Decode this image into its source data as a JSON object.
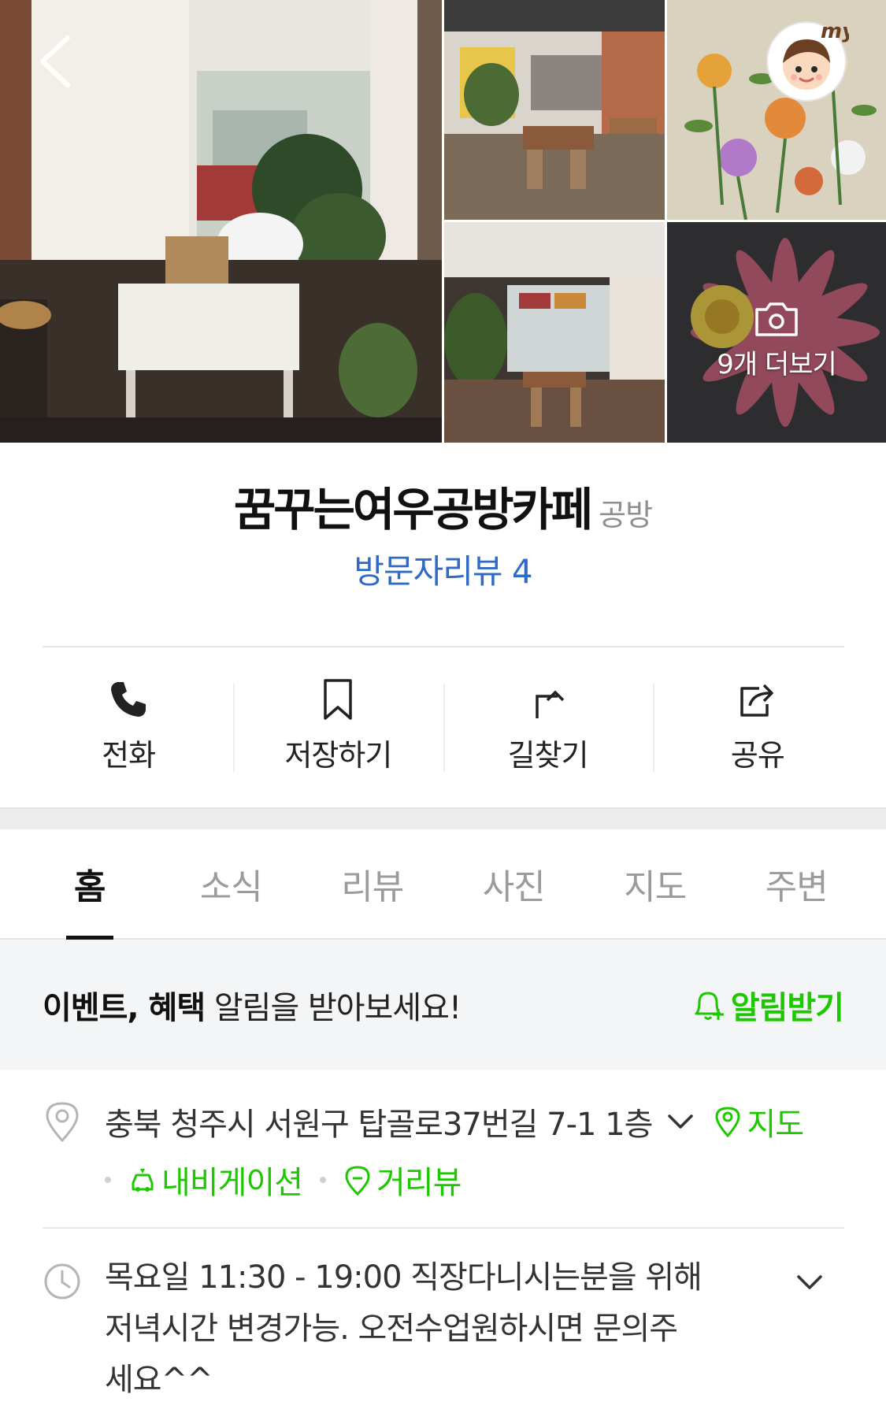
{
  "gallery": {
    "more_label": "9개 더보기",
    "images": [
      {
        "name": "interior-window-photo"
      },
      {
        "name": "cafe-tables-photo"
      },
      {
        "name": "embroidery-flowers-photo"
      },
      {
        "name": "cafe-hall-photo"
      },
      {
        "name": "embroidery-flower-closeup-photo"
      }
    ],
    "my_badge": "my"
  },
  "place": {
    "name": "꿈꾸는여우공방카페",
    "category": "공방",
    "review_label": "방문자리뷰 4"
  },
  "actions": [
    {
      "label": "전화",
      "icon": "phone-icon"
    },
    {
      "label": "저장하기",
      "icon": "bookmark-icon"
    },
    {
      "label": "길찾기",
      "icon": "directions-icon"
    },
    {
      "label": "공유",
      "icon": "share-icon"
    }
  ],
  "tabs": [
    {
      "label": "홈",
      "active": true
    },
    {
      "label": "소식"
    },
    {
      "label": "리뷰"
    },
    {
      "label": "사진"
    },
    {
      "label": "지도"
    },
    {
      "label": "주변"
    }
  ],
  "notice": {
    "bold_part": "이벤트, 혜택",
    "rest": " 알림을 받아보세요!",
    "button": "알림받기"
  },
  "address": {
    "text": "충북 청주시 서원구 탑골로37번길 7-1 1층",
    "map_label": "지도",
    "navigation_label": "내비게이션",
    "streetview_label": "거리뷰"
  },
  "hours": {
    "text": "목요일 11:30 - 19:00 직장다니시는분을 위해 저녁시간 변경가능. 오전수업원하시면 문의주세요^^"
  },
  "colors": {
    "accent_green": "#1ec800",
    "link_blue": "#2f6bc6",
    "banner_bg": "#f4f5f7"
  }
}
